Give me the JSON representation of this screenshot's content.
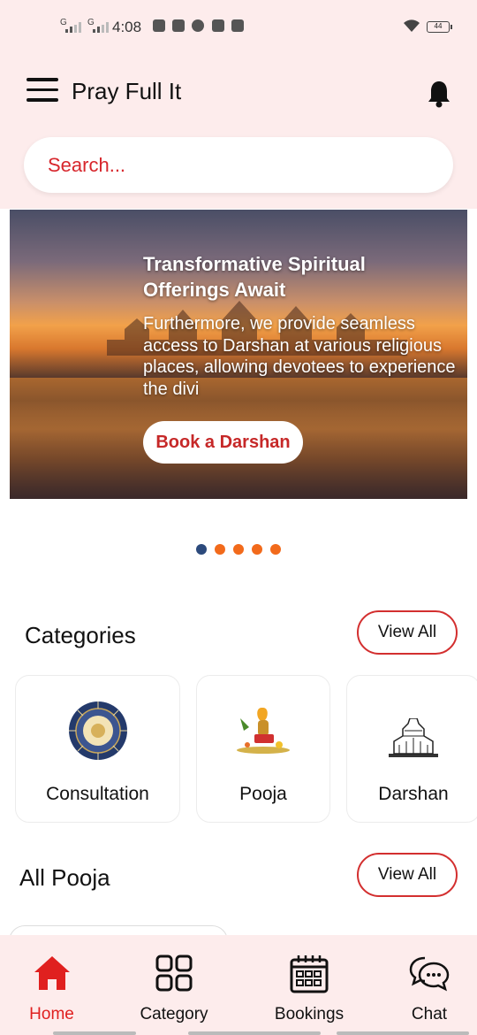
{
  "status_bar": {
    "time": "4:08",
    "signal_1": "G",
    "signal_2": "G",
    "battery": "44"
  },
  "app_bar": {
    "title": "Pray Full It",
    "menu_icon": "menu-icon",
    "bell_icon": "bell-icon"
  },
  "search": {
    "placeholder": "Search..."
  },
  "banner": {
    "title": "Transformative Spiritual Offerings Await",
    "text": "Furthermore, we provide seamless access to Darshan at various religious places, allowing devotees to experience the divi",
    "button_label": "Book a Darshan",
    "slides": 5,
    "active_slide": 1
  },
  "categories": {
    "title": "Categories",
    "view_all_label": "View All",
    "items": [
      {
        "label": "Consultation",
        "icon": "zodiac-wheel-icon"
      },
      {
        "label": "Pooja",
        "icon": "pooja-thali-icon"
      },
      {
        "label": "Darshan",
        "icon": "temple-icon"
      }
    ]
  },
  "all_pooja": {
    "title": "All Pooja",
    "view_all_label": "View All"
  },
  "bottom_nav": {
    "items": [
      {
        "label": "Home",
        "icon": "home-icon",
        "active": true
      },
      {
        "label": "Category",
        "icon": "grid-icon",
        "active": false
      },
      {
        "label": "Bookings",
        "icon": "calendar-icon",
        "active": false
      },
      {
        "label": "Chat",
        "icon": "chat-bubbles-icon",
        "active": false
      }
    ]
  },
  "colors": {
    "accent": "#e0201f",
    "header_bg": "#fdecec",
    "dot_inactive": "#f26a1b",
    "dot_active": "#2c4a7c"
  }
}
